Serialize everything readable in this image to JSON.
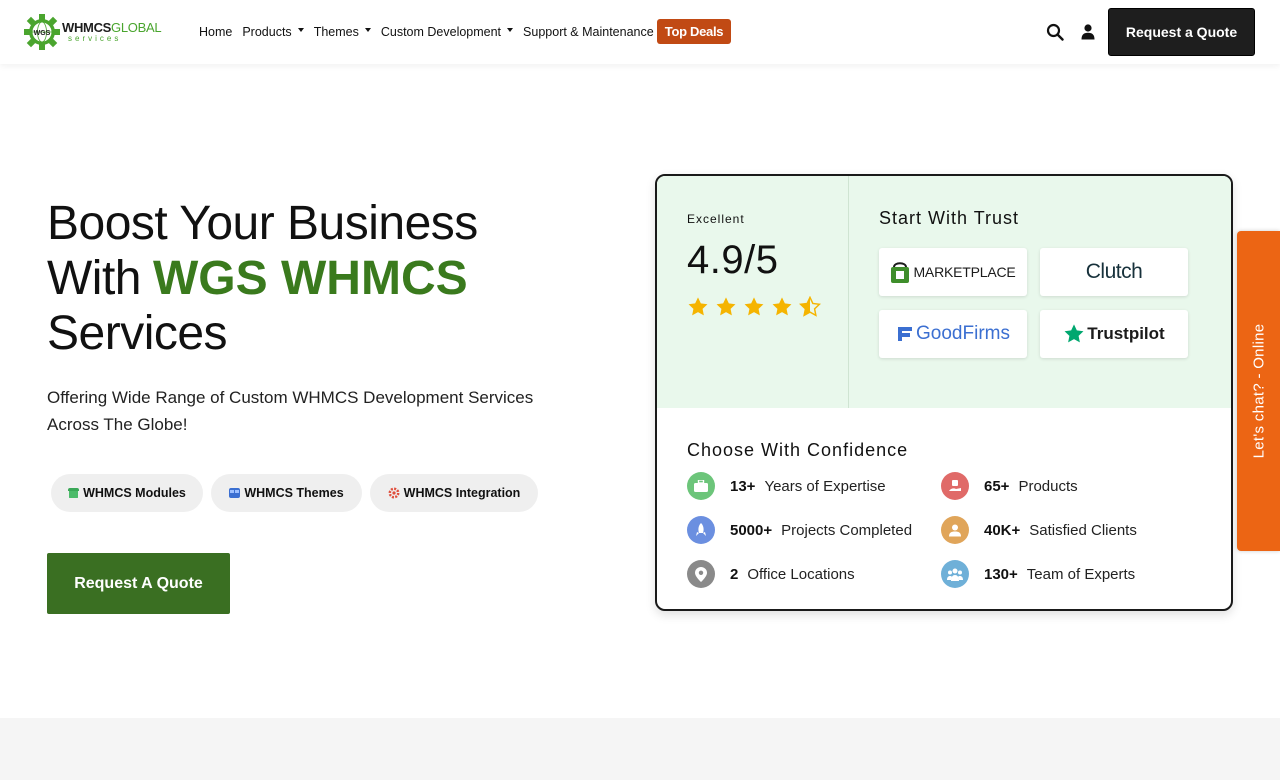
{
  "header": {
    "logo": {
      "brand": "WHMCS",
      "brand_accent": "GLOBAL",
      "tagline": "services",
      "gear_text": "WGS"
    },
    "nav": [
      {
        "label": "Home",
        "has_dropdown": false
      },
      {
        "label": "Products",
        "has_dropdown": true
      },
      {
        "label": "Themes",
        "has_dropdown": true
      },
      {
        "label": "Custom Development",
        "has_dropdown": true
      },
      {
        "label": "Support & Maintenance",
        "has_dropdown": false
      }
    ],
    "deals_label": "Top Deals",
    "quote_label": "Request a Quote",
    "icons": [
      "search-icon",
      "user-icon"
    ]
  },
  "hero": {
    "title_line1": "Boost Your Business",
    "title_line2_prefix": "With",
    "title_line2_accent": "WGS WHMCS",
    "title_line3": "Services",
    "subtitle_line1": "Offering Wide Range of Custom WHMCS Development Services",
    "subtitle_line2": "Across The Globe!",
    "pills": [
      {
        "label": "WHMCS Modules",
        "icon": "module-icon"
      },
      {
        "label": "WHMCS Themes",
        "icon": "theme-icon"
      },
      {
        "label": "WHMCS Integration",
        "icon": "integration-icon"
      }
    ],
    "cta_label": "Request A Quote"
  },
  "trust": {
    "rating_label": "Excellent",
    "rating_value": "4.9/5",
    "rating_stars": 4.9,
    "title": "Start With Trust",
    "badges": [
      {
        "name": "MARKETPLACE",
        "icon": "marketplace-bag-icon"
      },
      {
        "name": "Clutch",
        "icon": "clutch-logo"
      },
      {
        "name": "GoodFirms",
        "icon": "goodfirms-logo"
      },
      {
        "name": "Trustpilot",
        "icon": "trustpilot-star-icon"
      }
    ],
    "confidence_title": "Choose With Confidence",
    "stats": [
      {
        "num": "13+",
        "label": "Years of Expertise",
        "icon": "briefcase-icon",
        "color": "#6cc57a"
      },
      {
        "num": "65+",
        "label": "Products",
        "icon": "hand-product-icon",
        "color": "#e06a68"
      },
      {
        "num": "5000+",
        "label": "Projects Completed",
        "icon": "rocket-icon",
        "color": "#6b8fe0"
      },
      {
        "num": "40K+",
        "label": "Satisfied Clients",
        "icon": "client-icon",
        "color": "#e0a55a"
      },
      {
        "num": "2",
        "label": "Office Locations",
        "icon": "location-pin-icon",
        "color": "#8a8a8a"
      },
      {
        "num": "130+",
        "label": "Team of Experts",
        "icon": "team-icon",
        "color": "#6fb0d8"
      }
    ]
  },
  "chat_tab": {
    "label": "Let's chat? - Online"
  },
  "colors": {
    "accent_green": "#3a7a1d",
    "cta_green": "#3a6f22",
    "deal_orange": "#c14a14",
    "chat_orange": "#ec6514",
    "card_bg": "#e9f8ec"
  }
}
